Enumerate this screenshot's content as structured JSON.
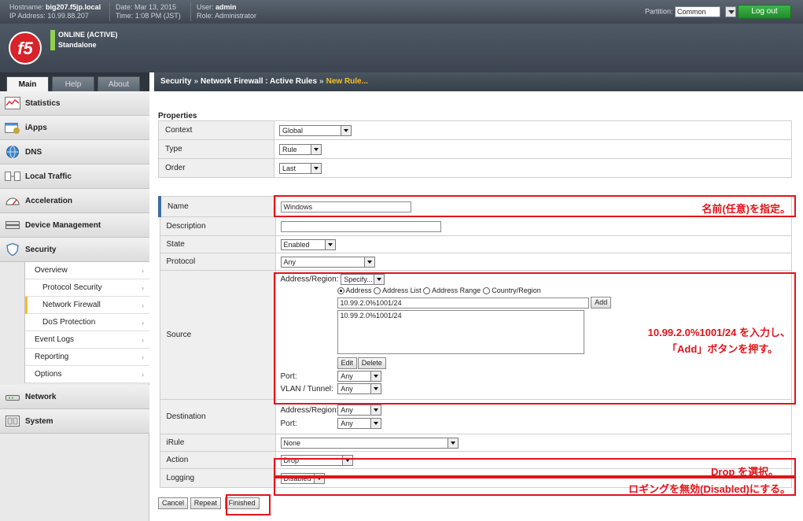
{
  "topbar": {
    "hostname_label": "Hostname:",
    "hostname": "big207.f5jp.local",
    "ip_label": "IP Address:",
    "ip": "10.99.88.207",
    "date_label": "Date:",
    "date": "Mar 13, 2015",
    "time_label": "Time:",
    "time": "1:08 PM (JST)",
    "user_label": "User:",
    "user": "admin",
    "role_label": "Role:",
    "role": "Administrator",
    "partition_label": "Partition:",
    "partition_value": "Common",
    "logout": "Log out"
  },
  "header": {
    "logo": "f5",
    "status_line1": "ONLINE (ACTIVE)",
    "status_line2": "Standalone"
  },
  "tabs": [
    "Main",
    "Help",
    "About"
  ],
  "breadcrumb": {
    "part1": "Security",
    "sep": "»",
    "part2": "Network Firewall : Active Rules",
    "current": "New Rule..."
  },
  "nav": {
    "statistics": "Statistics",
    "iapps": "iApps",
    "dns": "DNS",
    "local_traffic": "Local Traffic",
    "acceleration": "Acceleration",
    "device_management": "Device Management",
    "security": "Security",
    "network": "Network",
    "system": "System"
  },
  "security_sub": [
    "Overview",
    "Protocol Security",
    "Network Firewall",
    "DoS Protection",
    "Event Logs",
    "Reporting",
    "Options"
  ],
  "properties": {
    "title": "Properties",
    "context_label": "Context",
    "context_value": "Global",
    "type_label": "Type",
    "type_value": "Rule",
    "order_label": "Order",
    "order_value": "Last"
  },
  "rule": {
    "name_label": "Name",
    "name_value": "Windows",
    "description_label": "Description",
    "description_value": "",
    "state_label": "State",
    "state_value": "Enabled",
    "protocol_label": "Protocol",
    "protocol_value": "Any",
    "source_label": "Source",
    "addr_region_label": "Address/Region:",
    "addr_region_value": "Specify...",
    "radio_address": "Address",
    "radio_address_list": "Address List",
    "radio_address_range": "Address Range",
    "radio_country": "Country/Region",
    "address_input": "10.99.2.0%1001/24",
    "add_button": "Add",
    "address_list_item": "10.99.2.0%1001/24",
    "edit_button": "Edit",
    "delete_button": "Delete",
    "port_label": "Port:",
    "port_value": "Any",
    "vlan_label": "VLAN / Tunnel:",
    "vlan_value": "Any",
    "destination_label": "Destination",
    "dest_addr_label": "Address/Region:",
    "dest_addr_value": "Any",
    "dest_port_label": "Port:",
    "dest_port_value": "Any",
    "irule_label": "iRule",
    "irule_value": "None",
    "action_label": "Action",
    "action_value": "Drop",
    "logging_label": "Logging",
    "logging_value": "Disabled"
  },
  "buttons": {
    "cancel": "Cancel",
    "repeat": "Repeat",
    "finished": "Finished"
  },
  "annotations": {
    "name_note": "名前(任意)を指定。",
    "source_note_line1": "10.99.2.0%1001/24 を入力し、",
    "source_note_line2": "「Add」ボタンを押す。",
    "action_note": "Drop を選択。",
    "logging_note": "ロギングを無効(Disabled)にする。"
  },
  "colors": {
    "annotation_red": "#e2141a",
    "logout_green": "#2aa034",
    "breadcrumb_current": "#f5c028",
    "online_green": "#8fd14f"
  }
}
